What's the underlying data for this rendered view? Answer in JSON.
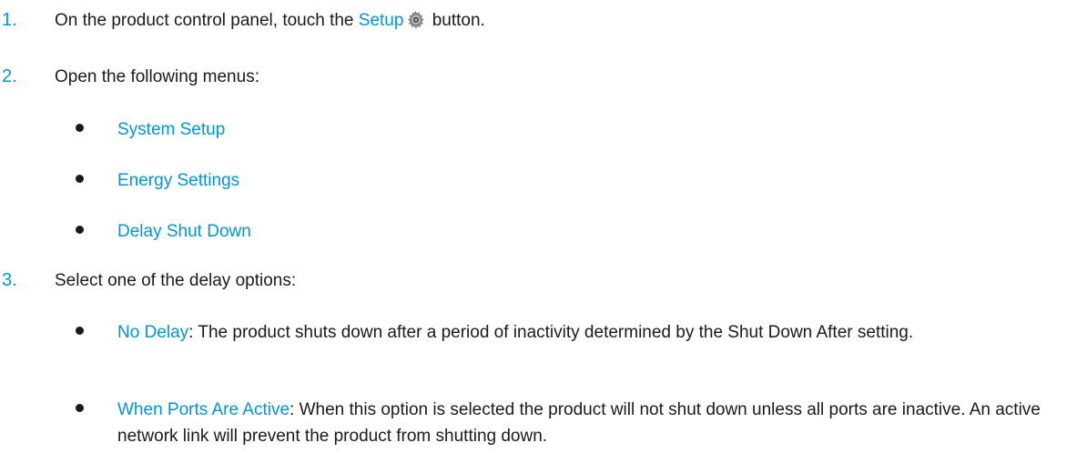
{
  "steps": [
    {
      "number": "1.",
      "prefix": "On the product control panel, touch the ",
      "link": "Setup",
      "icon": "gear-icon",
      "suffix": " button."
    },
    {
      "number": "2.",
      "text": "Open the following menus:",
      "items": [
        "System Setup",
        "Energy Settings",
        "Delay Shut Down"
      ]
    },
    {
      "number": "3.",
      "text": "Select one of the delay options:",
      "options": [
        {
          "name": "No Delay",
          "description": ": The product shuts down after a period of inactivity determined by the Shut Down After setting."
        },
        {
          "name": "When Ports Are Active",
          "description": ": When this option is selected the product will not shut down unless all ports are inactive. An active network link will prevent the product from shutting down."
        }
      ]
    }
  ],
  "colors": {
    "accent": "#0096d6",
    "text": "#1a1a1a"
  }
}
